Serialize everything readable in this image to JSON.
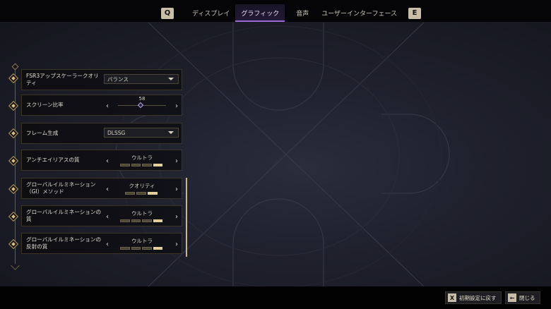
{
  "header": {
    "prev_key": "Q",
    "next_key": "E",
    "tabs": [
      {
        "label": "ディスプレイ",
        "active": false
      },
      {
        "label": "グラフィック",
        "active": true
      },
      {
        "label": "音声",
        "active": false
      },
      {
        "label": "ユーザーインターフェース",
        "active": false
      }
    ]
  },
  "settings": [
    {
      "label": "FSR3アップスケーラークオリティ",
      "control": "dropdown",
      "value": "バランス"
    },
    {
      "label": "スクリーン比率",
      "control": "slider",
      "value": "58",
      "level": 0.5
    },
    {
      "label": "フレーム生成",
      "control": "dropdown",
      "value": "DLSSG"
    },
    {
      "label": "アンチエイリアスの質",
      "control": "selector",
      "value": "ウルトラ",
      "steps": 4,
      "filled": 4
    },
    {
      "label": "グローバルイルミネーション（GI）メソッド",
      "control": "selector",
      "value": "クオリティ",
      "steps": 3,
      "filled": 3
    },
    {
      "label": "グローバルイルミネーションの質",
      "control": "selector",
      "value": "ウルトラ",
      "steps": 4,
      "filled": 4
    },
    {
      "label": "グローバルイルミネーションの反射の質",
      "control": "selector",
      "value": "ウルトラ",
      "steps": 4,
      "filled": 4
    }
  ],
  "footer": {
    "reset_key": "X",
    "reset_label": "初期設定に戻す",
    "close_icon": "back-arrow-icon",
    "close_label": "閉じる"
  },
  "colors": {
    "accent": "#9a6ad8",
    "gold": "#d9bf7c",
    "keycap": "#c9bfa8"
  }
}
